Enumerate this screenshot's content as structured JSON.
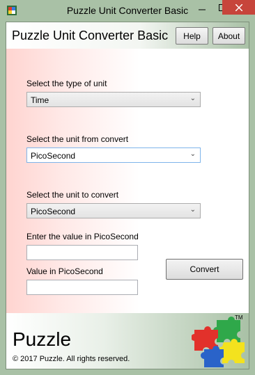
{
  "window": {
    "title": "Puzzle Unit Converter Basic",
    "icons": {
      "app": "puzzle-app-icon",
      "minimize": "minimize-icon",
      "maximize": "maximize-icon",
      "close": "close-icon"
    },
    "colors": {
      "chrome": "#a9c1a6",
      "close": "#c7453b",
      "focus_border": "#7eb4ea"
    }
  },
  "header": {
    "title": "Puzzle Unit Converter Basic",
    "help_label": "Help",
    "about_label": "About"
  },
  "form": {
    "type_label": "Select the type of unit",
    "type_value": "Time",
    "from_label": "Select the unit from convert",
    "from_value": "PicoSecond",
    "to_label": "Select the unit to convert",
    "to_value": "PicoSecond",
    "input_label": "Enter the value in PicoSecond",
    "input_value": "",
    "output_label": "Value in PicoSecond",
    "output_value": "",
    "convert_label": "Convert"
  },
  "footer": {
    "brand": "Puzzle",
    "copyright": "© 2017 Puzzle. All rights reserved.",
    "trademark": "TM",
    "logo_icon": "puzzle-pieces-logo"
  }
}
